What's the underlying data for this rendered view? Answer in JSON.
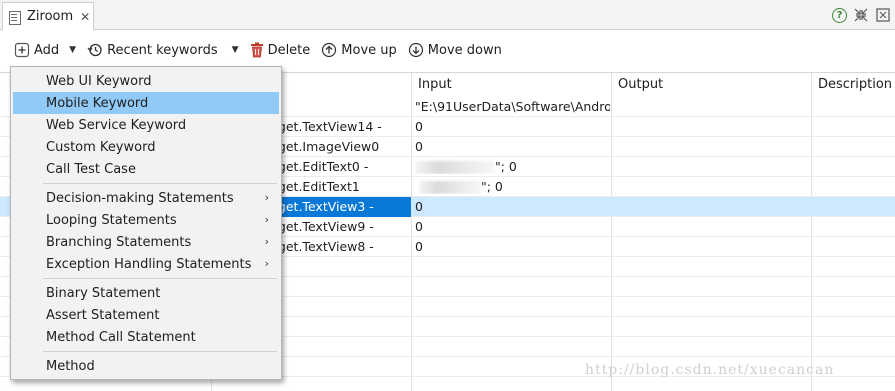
{
  "tab": {
    "title": "Ziroom",
    "close_glyph": "✕"
  },
  "tab_tools": {
    "help_glyph": "?"
  },
  "toolbar": {
    "add_label": "Add",
    "recent_label": "Recent keywords",
    "delete_label": "Delete",
    "move_up_label": "Move up",
    "move_down_label": "Move down"
  },
  "table": {
    "columns": {
      "input": "Input",
      "output": "Output",
      "description": "Description"
    },
    "rows": [
      {
        "target": "",
        "input": "\"E:\\91UserData\\Software\\Androic"
      },
      {
        "target": "dget.TextView14 -",
        "input": "0"
      },
      {
        "target": "dget.ImageView0",
        "input": "0"
      },
      {
        "target": "dget.EditText0 -",
        "input": "\"; 0"
      },
      {
        "target": "dget.EditText1",
        "input": "\"; 0"
      },
      {
        "target": "dget.TextView3 -",
        "input": "0"
      },
      {
        "target": "dget.TextView9 -",
        "input": "0"
      },
      {
        "target": "dget.TextView8 -",
        "input": "0"
      }
    ]
  },
  "menu": {
    "items": [
      {
        "label": "Web UI Keyword"
      },
      {
        "label": "Mobile Keyword"
      },
      {
        "label": "Web Service Keyword"
      },
      {
        "label": "Custom Keyword"
      },
      {
        "label": "Call Test Case"
      },
      {
        "label": "Decision-making Statements"
      },
      {
        "label": "Looping Statements"
      },
      {
        "label": "Branching Statements"
      },
      {
        "label": "Exception Handling Statements"
      },
      {
        "label": "Binary Statement"
      },
      {
        "label": "Assert Statement"
      },
      {
        "label": "Method Call Statement"
      },
      {
        "label": "Method"
      }
    ],
    "submenu_arrow": "›"
  },
  "watermark": "http://blog.csdn.net/xuecancan",
  "colors": {
    "highlight": "#91c9f7",
    "selected_row": "#cde8ff",
    "selected_cell": "#0a78d7"
  }
}
